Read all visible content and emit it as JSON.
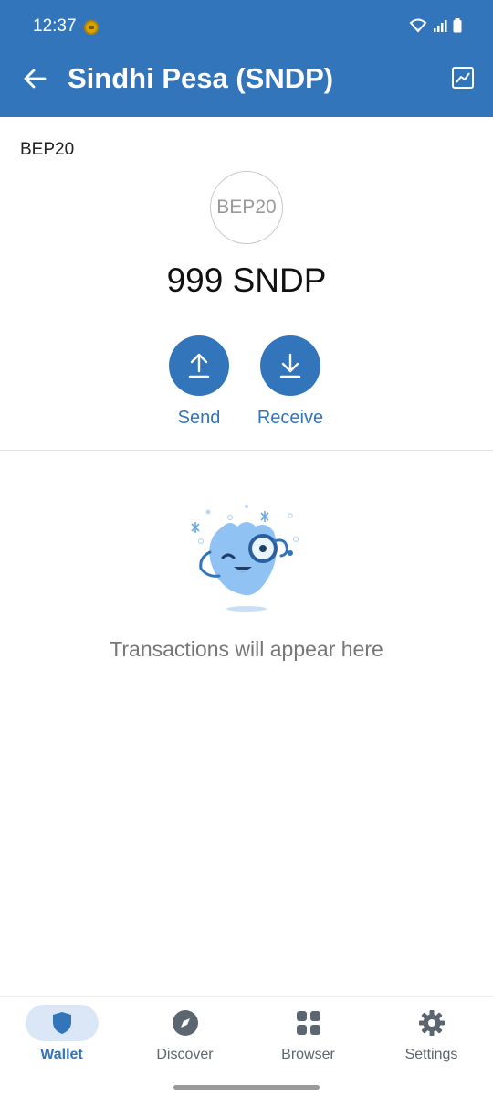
{
  "status_bar": {
    "time": "12:37"
  },
  "app_bar": {
    "title": "Sindhi Pesa (SNDP)",
    "back_icon": "arrow-left-icon",
    "chart_icon": "chart-icon"
  },
  "token": {
    "network": "BEP20",
    "logo_text": "BEP20",
    "balance": "999 SNDP"
  },
  "actions": {
    "send_label": "Send",
    "receive_label": "Receive"
  },
  "empty_state": {
    "message": "Transactions will appear here"
  },
  "bottom_nav": {
    "items": [
      {
        "label": "Wallet",
        "icon": "shield-icon",
        "active": true
      },
      {
        "label": "Discover",
        "icon": "compass-icon",
        "active": false
      },
      {
        "label": "Browser",
        "icon": "grid-icon",
        "active": false
      },
      {
        "label": "Settings",
        "icon": "gear-icon",
        "active": false
      }
    ]
  },
  "colors": {
    "primary": "#3375bb",
    "active_nav_bg": "#dbe7f6",
    "muted_text": "#777777"
  }
}
